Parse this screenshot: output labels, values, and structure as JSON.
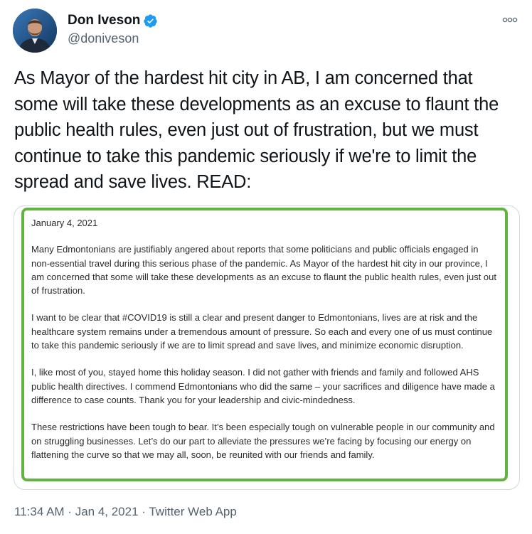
{
  "author": {
    "display_name": "Don Iveson",
    "handle": "@doniveson",
    "verified": true
  },
  "more_icon": "more-dots-icon",
  "tweet_text": "As Mayor of the hardest hit city in AB, I am concerned that some will take these developments as an excuse to flaunt the public health rules, even just out of frustration, but we must continue to take this pandemic seriously if we're to limit the spread and save lives. READ:",
  "letter": {
    "date": "January 4, 2021",
    "paragraphs": [
      "Many Edmontonians are justifiably angered about reports that some politicians and public officials engaged in non-essential travel during this serious phase of the pandemic. As Mayor of the hardest hit city in our province, I am concerned that some will take these developments as an excuse to flaunt the public health rules, even just out of frustration.",
      "I want to be clear that #COVID19 is still a clear and present danger to Edmontonians, lives are at risk and the healthcare system remains under a tremendous amount of pressure. So each and every one of us must continue to take this pandemic seriously if we are to limit spread and save lives, and minimize economic disruption.",
      "I, like most of you, stayed home this holiday season. I did not gather with friends and family and followed AHS public health directives. I commend Edmontonians who did the same – your sacrifices and diligence have made a difference to case counts. Thank you for your leadership and civic-mindedness.",
      "These restrictions have been tough to bear. It’s been especially tough on vulnerable people in our community and on struggling businesses. Let’s do our part to alleviate the pressures we’re facing by focusing our energy on flattening the curve so that we may all, soon, be reunited with our friends and family."
    ]
  },
  "meta": {
    "time": "11:34 AM",
    "separator": " · ",
    "date": "Jan 4, 2021",
    "source": "Twitter Web App"
  },
  "colors": {
    "verified": "#1d9bf0",
    "letter_border": "#63b342",
    "secondary_text": "#536471"
  }
}
